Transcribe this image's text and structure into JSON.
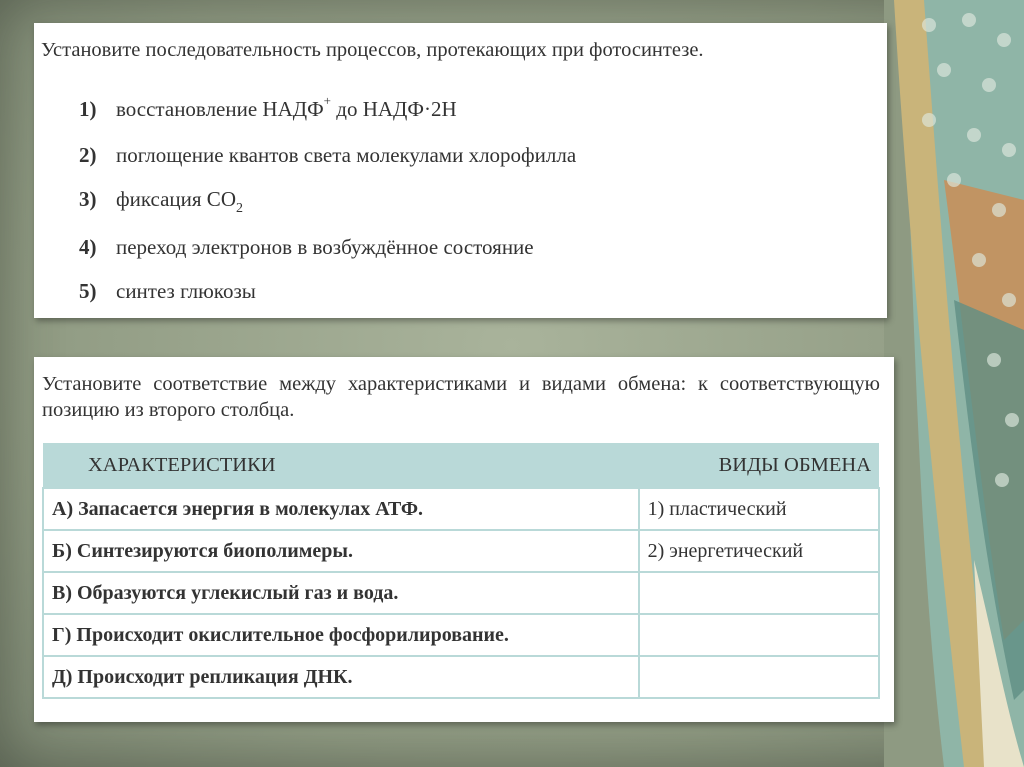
{
  "task1": {
    "question": "Установите последовательность процессов, протекающих при фотосинтезе.",
    "items": [
      {
        "num": "1)",
        "text_pre": "восстановление НАДФ",
        "sup": "+",
        "text_post": " до НАДФ·2Н"
      },
      {
        "num": "2)",
        "text_pre": "поглощение квантов света молекулами хлорофилла",
        "sup": "",
        "text_post": ""
      },
      {
        "num": "3)",
        "text_pre": "фиксация СО",
        "sub": "2",
        "text_post": ""
      },
      {
        "num": "4)",
        "text_pre": "переход электронов в возбуждённое состояние",
        "sup": "",
        "text_post": ""
      },
      {
        "num": "5)",
        "text_pre": "синтез глюкозы",
        "sup": "",
        "text_post": ""
      }
    ]
  },
  "task2": {
    "question": "Установите соответствие между характеристиками и видами обмена: к соответствующую позицию из второго столбца.",
    "col_left": "ХАРАКТЕРИСТИКИ",
    "col_right": "ВИДЫ ОБМЕНА",
    "rows": [
      {
        "left": "А) Запасается энергия в молекулах АТФ.",
        "right": "1) пластический"
      },
      {
        "left": "Б) Синтезируются биополимеры.",
        "right": "2) энергетический"
      },
      {
        "left": "В) Образуются углекислый газ и вода.",
        "right": ""
      },
      {
        "left": "Г) Происходит окислительное фосфорилирование.",
        "right": ""
      },
      {
        "left": "Д) Происходит репликация ДНК.",
        "right": ""
      }
    ]
  },
  "colors": {
    "background": "#9ea88f",
    "table_header": "#b9d9d8",
    "text": "#333333"
  }
}
